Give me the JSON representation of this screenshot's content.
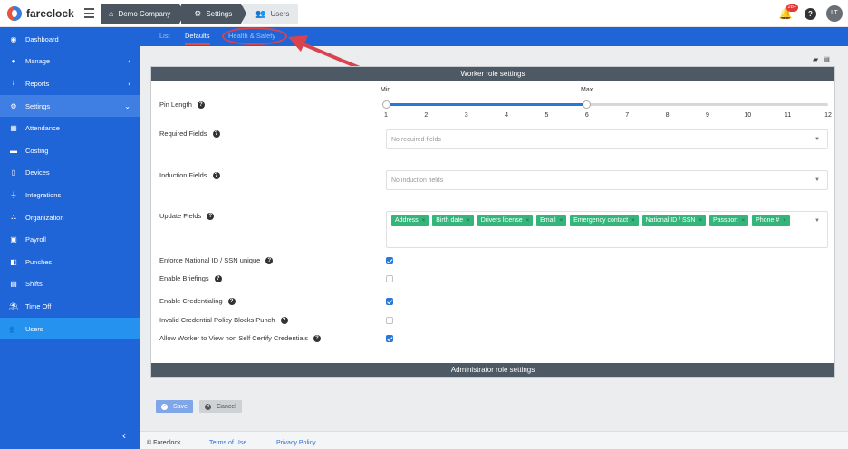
{
  "app": {
    "brand": "fareclock"
  },
  "breadcrumb": [
    {
      "label": "Demo Company",
      "icon": "home-icon"
    },
    {
      "label": "Settings",
      "icon": "gear-icon"
    },
    {
      "label": "Users",
      "icon": "users-icon"
    }
  ],
  "header": {
    "notifications_badge": "28+",
    "help_label": "?",
    "avatar_initials": "LT"
  },
  "sidebar": {
    "items": [
      {
        "label": "Dashboard",
        "icon": "dashboard-icon"
      },
      {
        "label": "Manage",
        "icon": "person-icon",
        "chevron": "‹"
      },
      {
        "label": "Reports",
        "icon": "chart-icon",
        "chevron": "‹"
      },
      {
        "label": "Settings",
        "icon": "gear-icon",
        "chevron": "⌄"
      },
      {
        "label": "Attendance",
        "icon": "attendance-icon"
      },
      {
        "label": "Costing",
        "icon": "costing-icon"
      },
      {
        "label": "Devices",
        "icon": "device-icon"
      },
      {
        "label": "Integrations",
        "icon": "plug-icon"
      },
      {
        "label": "Organization",
        "icon": "org-icon"
      },
      {
        "label": "Payroll",
        "icon": "payroll-icon"
      },
      {
        "label": "Punches",
        "icon": "punch-icon"
      },
      {
        "label": "Shifts",
        "icon": "shift-icon"
      },
      {
        "label": "Time Off",
        "icon": "time-off-icon"
      },
      {
        "label": "Users",
        "icon": "users-icon"
      }
    ],
    "collapse": "‹"
  },
  "subtabs": {
    "list": "List",
    "defaults": "Defaults",
    "health_safety": "Health & Safety"
  },
  "panel": {
    "worker_title": "Worker role settings",
    "admin_title": "Administrator role settings",
    "pin_length": {
      "label": "Pin Length",
      "min_label": "Min",
      "max_label": "Max",
      "min_value": 1,
      "max_value": 6,
      "ticks": [
        "1",
        "2",
        "3",
        "4",
        "5",
        "6",
        "7",
        "8",
        "9",
        "10",
        "11",
        "12"
      ]
    },
    "required_fields": {
      "label": "Required Fields",
      "placeholder": "No required fields"
    },
    "induction_fields": {
      "label": "Induction Fields",
      "placeholder": "No induction fields"
    },
    "update_fields": {
      "label": "Update Fields",
      "tags": [
        "Address",
        "Birth date",
        "Drivers license",
        "Email",
        "Emergency contact",
        "National ID / SSN",
        "Passport",
        "Phone #"
      ]
    },
    "checkboxes": [
      {
        "label": "Enforce National ID / SSN unique",
        "checked": true
      },
      {
        "label": "Enable Briefings",
        "checked": false
      },
      {
        "label": "Enable Credentialing",
        "checked": true
      },
      {
        "label": "Invalid Credential Policy Blocks Punch",
        "checked": false
      },
      {
        "label": "Allow Worker to View non Self Certify Credentials",
        "checked": true
      }
    ]
  },
  "actions": {
    "save": "Save",
    "cancel": "Cancel"
  },
  "footer": {
    "copyright": "© Fareclock",
    "terms": "Terms of Use",
    "privacy": "Privacy Policy"
  },
  "colors": {
    "sidebar": "#1f65d8",
    "active": "#2592ef",
    "tag": "#34b57a",
    "annotation": "#d8434e"
  }
}
